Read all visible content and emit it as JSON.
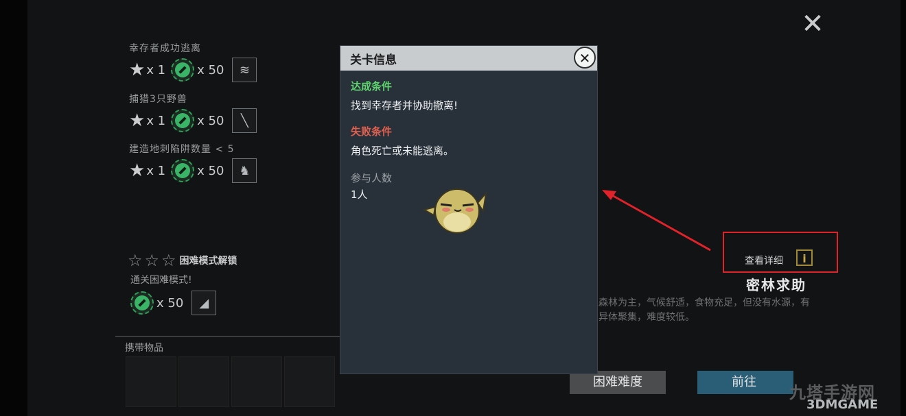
{
  "rewards": [
    {
      "title": "幸存者成功逃离",
      "star": "★",
      "star_count": "x 1",
      "coin_count": "x 50",
      "item_icon": "≋"
    },
    {
      "title": "捕猎3只野兽",
      "star": "★",
      "star_count": "x 1",
      "coin_count": "x 50",
      "item_icon": "╲"
    },
    {
      "title": "建造地刺陷阱数量 < 5",
      "star": "★",
      "star_count": "x 1",
      "coin_count": "x 50",
      "item_icon": "♞"
    }
  ],
  "hard_mode": {
    "stars": "☆",
    "label": "困难模式解锁",
    "subtitle": "通关困难模式!",
    "coin_count": "x 50",
    "item_icon": "◢"
  },
  "carry": {
    "title": "携带物品"
  },
  "detail": {
    "label": "查看详细",
    "icon": "i"
  },
  "level": {
    "name": "密林求助",
    "description": "地形以森林为主，气候舒适，食物充足，但没有水源，有少量变异体聚集，难度较低。"
  },
  "buttons": {
    "hard": "困难难度",
    "go": "前往"
  },
  "watermark": {
    "text": "九塔手游网",
    "brand": "3DMGAME"
  },
  "main_close": "✕",
  "modal": {
    "title": "关卡信息",
    "close": "✕",
    "success_title": "达成条件",
    "success_text": "找到幸存者并协助撤离!",
    "fail_title": "失败条件",
    "fail_text": "角色死亡或未能逃离。",
    "players_title": "参与人数",
    "players_text": "1人"
  },
  "colors": {
    "success": "#5fd46e",
    "fail": "#e0604f",
    "highlight": "#e0232b"
  }
}
